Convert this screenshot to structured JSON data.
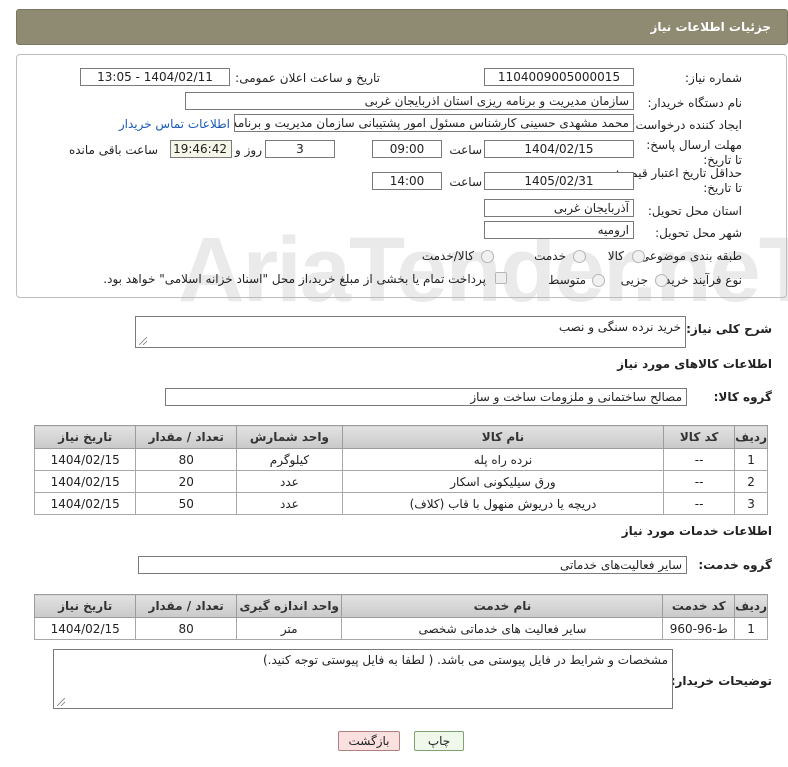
{
  "header": {
    "title": "جزئیات اطلاعات نیاز"
  },
  "watermark": "AriaTender.neT",
  "form": {
    "need_number_label": "شماره نیاز:",
    "need_number": "1104009005000015",
    "announce_label": "تاریخ و ساعت اعلان عمومی:",
    "announce_value": "1404/02/11 - 13:05",
    "buyer_org_label": "نام دستگاه خریدار:",
    "buyer_org": "سازمان مدیریت و برنامه ریزی استان اذربایجان غربی",
    "requester_label": "ایجاد کننده درخواست:",
    "requester": "محمد مشهدی حسینی کارشناس مسئول امور پشتیبانی سازمان مدیریت و برنامه",
    "contact_link": "اطلاعات تماس خریدار",
    "deadline_label": "مهلت ارسال پاسخ: تا تاریخ:",
    "deadline_date": "1404/02/15",
    "time_label": "ساعت",
    "deadline_time": "09:00",
    "days_value": "3",
    "days_label": "روز و",
    "remaining_time": "19:46:42",
    "remaining_label": "ساعت باقی مانده",
    "price_validity_label": "حداقل تاریخ اعتبار قیمت: تا تاریخ:",
    "price_validity_date": "1405/02/31",
    "price_validity_time": "14:00",
    "province_label": "استان محل تحویل:",
    "province": "آذربایجان غربی",
    "city_label": "شهر محل تحویل:",
    "city": "ارومیه",
    "category_label": "طبقه بندی موضوعی:",
    "category_options": [
      "کالا",
      "خدمت",
      "کالا/خدمت"
    ],
    "process_label": "نوع فرآیند خرید :",
    "process_options": [
      "جزیی",
      "متوسط"
    ],
    "payment_note": "پرداخت تمام یا بخشی از مبلغ خرید،از محل \"اسناد خزانه اسلامی\" خواهد بود."
  },
  "summary": {
    "label": "شرح کلی نیاز:",
    "value": "خرید نرده سنگی و نصب"
  },
  "goods": {
    "section_title": "اطلاعات کالاهای مورد نیاز",
    "group_label": "گروه کالا:",
    "group_value": "مصالح ساختمانی و ملزومات ساخت و ساز",
    "columns": [
      "ردیف",
      "کد کالا",
      "نام کالا",
      "واحد شمارش",
      "تعداد / مقدار",
      "تاریخ نیاز"
    ],
    "rows": [
      [
        "1",
        "--",
        "نرده راه پله",
        "کیلوگرم",
        "80",
        "1404/02/15"
      ],
      [
        "2",
        "--",
        "ورق سیلیکونی اسکار",
        "عدد",
        "20",
        "1404/02/15"
      ],
      [
        "3",
        "--",
        "دریچه یا دریوش منهول با قاب (کلاف)",
        "عدد",
        "50",
        "1404/02/15"
      ]
    ]
  },
  "services": {
    "section_title": "اطلاعات خدمات مورد نیاز",
    "group_label": "گروه خدمت:",
    "group_value": "سایر فعالیت‌های خدماتی",
    "columns": [
      "ردیف",
      "کد خدمت",
      "نام خدمت",
      "واحد اندازه گیری",
      "تعداد / مقدار",
      "تاریخ نیاز"
    ],
    "rows": [
      [
        "1",
        "ط-96-960",
        "سایر فعالیت های خدماتی شخصی",
        "متر",
        "80",
        "1404/02/15"
      ]
    ]
  },
  "buyer_notes": {
    "label": "توضیحات خریدار:",
    "value": "مشخصات و شرایط در فایل پیوستی می باشد. ( لطفا به فایل پیوستی توجه کنید.)"
  },
  "buttons": {
    "print": "چاپ",
    "back": "بازگشت"
  }
}
